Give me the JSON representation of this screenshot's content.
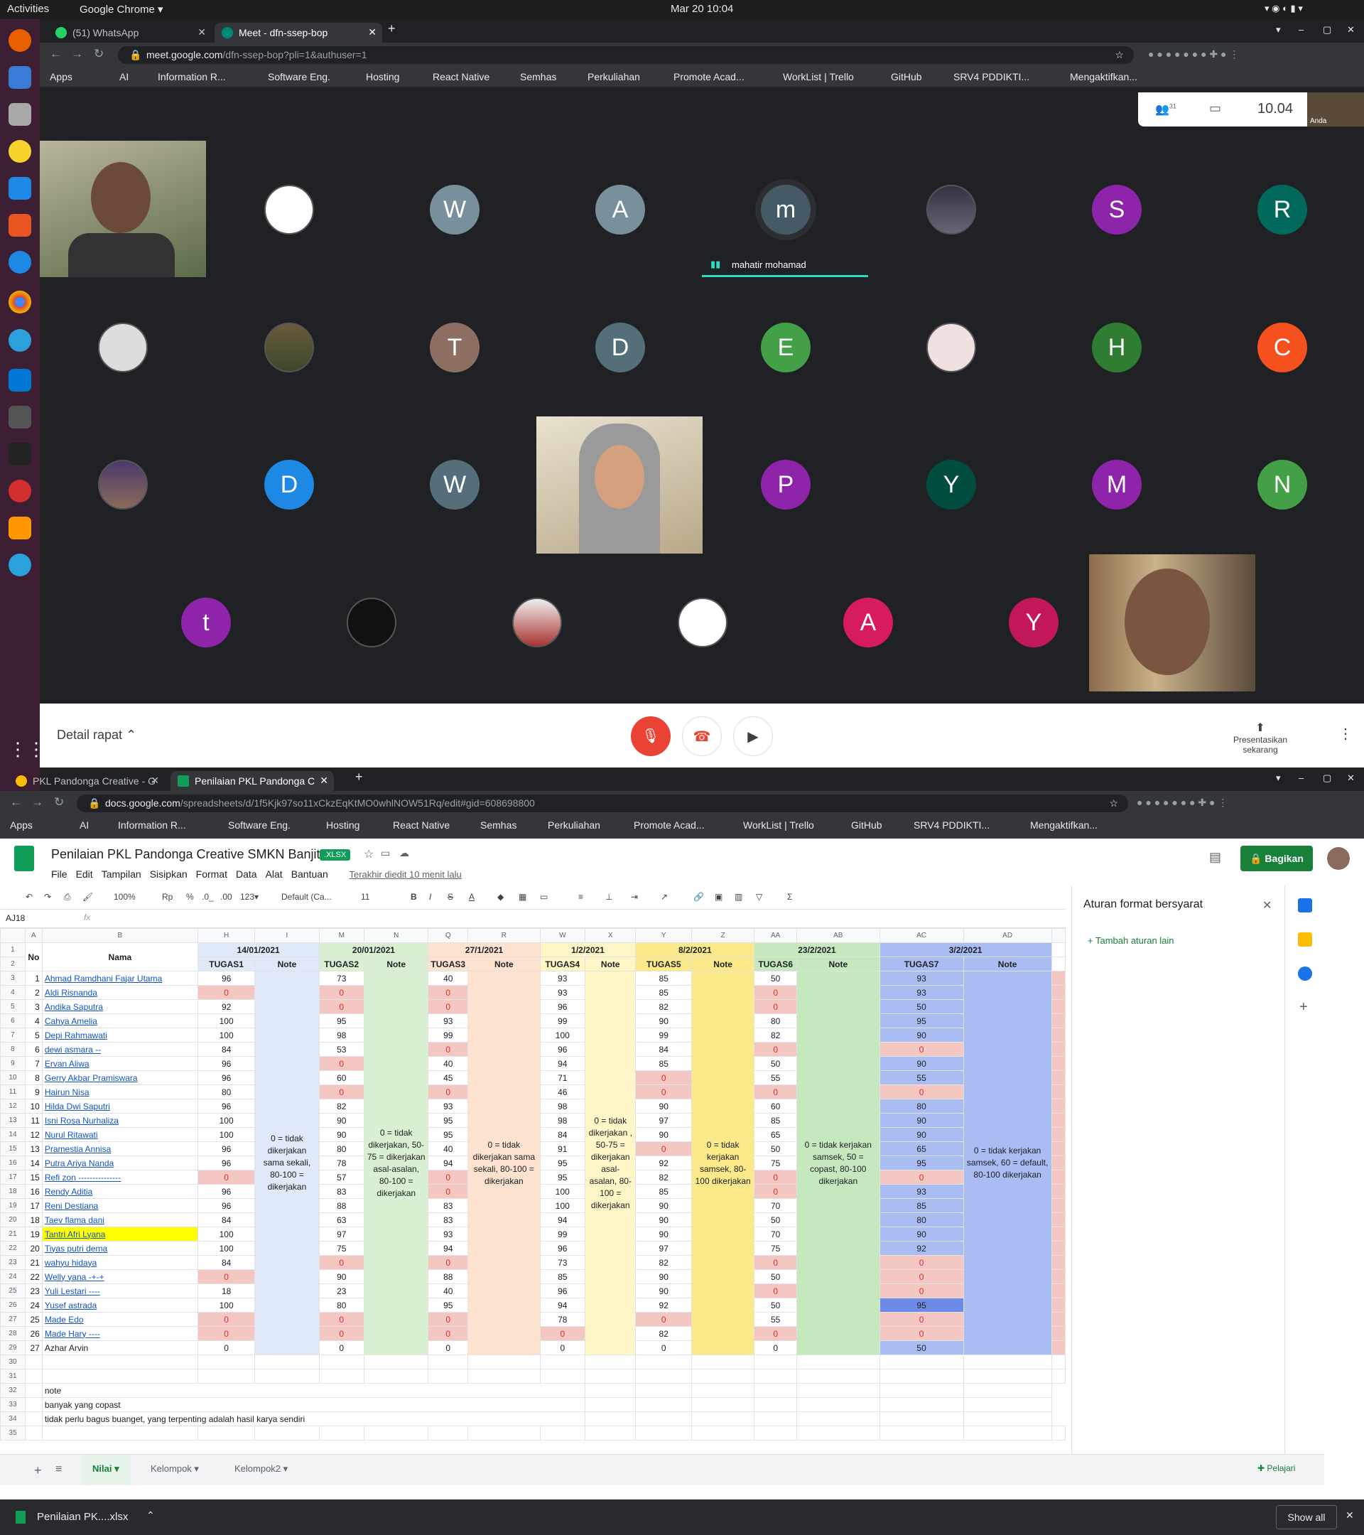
{
  "system": {
    "activities": "Activities",
    "app": "Google Chrome ▾",
    "clock": "Mar 20  10:04"
  },
  "meet_window": {
    "tabs": [
      {
        "label": "(51) WhatsApp"
      },
      {
        "label": "Meet - dfn-ssep-bop"
      }
    ],
    "url_host": "meet.google.com",
    "url_path": "/dfn-ssep-bop?pli=1&authuser=1",
    "bookmarks": [
      "Apps",
      "AI",
      "Information R...",
      "Software Eng.",
      "Hosting",
      "React Native",
      "Semhas",
      "Perkuliahan",
      "Promote Acad...",
      "WorkList | Trello",
      "GitHub",
      "SRV4 PDDIKTI...",
      "Mengaktifkan..."
    ],
    "participant_count": "31",
    "time": "10.04",
    "self_label": "Anda",
    "speaker_name": "mahatir mohamad",
    "rows": [
      [
        "video",
        "photo",
        "W",
        "A",
        "m",
        "photo",
        "S",
        "R"
      ],
      [
        "photo",
        "photo",
        "T",
        "D",
        "E",
        "photo",
        "H",
        "C"
      ],
      [
        "photo",
        "D",
        "W",
        "video",
        "P",
        "Y",
        "M",
        "N"
      ],
      [
        "t",
        "photo",
        "photo",
        "photo",
        "A",
        "Y",
        "video"
      ]
    ],
    "colors": {
      "W": "#78909c",
      "A": "#78909c",
      "m": "#455a64",
      "S": "#8e24aa",
      "R": "#00695c",
      "T": "#8d6e63",
      "D": "#546e7a",
      "E": "#43a047",
      "H": "#2e7d32",
      "C": "#f4511e",
      "P": "#8e24aa",
      "Y": "#004d40",
      "M": "#8e24aa",
      "N": "#43a047",
      "t": "#8e24aa",
      "A2": "#d81b60",
      "Y2": "#c2185b",
      "D2": "#1e88e5"
    },
    "details": "Detail rapat",
    "present": "Presentasikan sekarang"
  },
  "sheets_window": {
    "tabs": [
      {
        "label": "PKL Pandonga Creative - G"
      },
      {
        "label": "Penilaian PKL Pandonga C"
      }
    ],
    "url_host": "docs.google.com",
    "url_path": "/spreadsheets/d/1f5Kjk97so11xCkzEqKtMO0whlNOW51Rq/edit#gid=608698800",
    "title": "Penilaian PKL Pandonga Creative SMKN Banjit",
    "badge": ".XLSX",
    "menu": [
      "File",
      "Edit",
      "Tampilan",
      "Sisipkan",
      "Format",
      "Data",
      "Alat",
      "Bantuan"
    ],
    "last_edit": "Terakhir diedit 10 menit lalu",
    "share": "Bagikan",
    "toolbar": {
      "zoom": "100%",
      "currency": "Rp",
      "pct": "%",
      "dec0": ".0_",
      "dec00": ".00",
      "fmt": "123▾",
      "font": "Default (Ca...",
      "size": "11"
    },
    "cell_ref": "AJ18",
    "fx": "fx",
    "panel_title": "Aturan format bersyarat",
    "panel_add": "Tambah aturan lain",
    "col_letters": [
      "A",
      "B",
      "H",
      "I",
      "M",
      "N",
      "Q",
      "R",
      "W",
      "X",
      "Y",
      "Z",
      "AA",
      "AB",
      "AC",
      "AD"
    ],
    "dates": [
      "14/01/2021",
      "20/01/2021",
      "27/1/2021",
      "1/2/2021",
      "8/2/2021",
      "23/2/2021",
      "3/2/2021"
    ],
    "subheads": [
      "TUGAS1",
      "Note",
      "TUGAS2",
      "Note",
      "TUGAS3",
      "Note",
      "TUGAS4",
      "Note",
      "TUGAS5",
      "Note",
      "TUGAS6",
      "Note",
      "TUGAS7",
      "Note"
    ],
    "hdr_no": "No",
    "hdr_name": "Nama",
    "notes": [
      "0 = tidak dikerjakan sama sekali, 80-100 = dikerjakan",
      "0 = tidak dikerjakan, 50-75 = dikerjakan asal-asalan, 80-100 = dikerjakan",
      "0 = tidak dikerjakan sama sekali, 80-100 = dikerjakan",
      "0 = tidak dikerjakan , 50-75 = dikerjakan asal-asalan, 80-100 = dikerjakan",
      "0 = tidak kerjakan samsek, 80-100 dikerjakan",
      "0 = tidak kerjakan samsek, 50 = copast, 80-100 dikerjakan",
      "0 = tidak kerjakan samsek, 60 = default, 80-100 dikerjakan"
    ],
    "students": [
      [
        "1",
        "Ahmad Ramdhani Fajar Utama",
        "96",
        "73",
        "40",
        "93",
        "85",
        "50",
        "93"
      ],
      [
        "2",
        "Aldi Risnanda",
        "0",
        "0",
        "0",
        "93",
        "85",
        "0",
        "93"
      ],
      [
        "3",
        "Andika Saputra",
        "92",
        "0",
        "0",
        "96",
        "82",
        "0",
        "50"
      ],
      [
        "4",
        "Cahya Amelia ",
        "100",
        "95",
        "93",
        "99",
        "90",
        "80",
        "95"
      ],
      [
        "5",
        "Depi Rahmawati",
        "100",
        "98",
        "99",
        "100",
        "99",
        "82",
        "90"
      ],
      [
        "6",
        "dewi asmara --",
        "84",
        "53",
        "0",
        "96",
        "84",
        "0",
        "0"
      ],
      [
        "7",
        "Ervan Aliwa",
        "96",
        "0",
        "40",
        "94",
        "85",
        "50",
        "90"
      ],
      [
        "8",
        "Gerry Akbar Pramiswara",
        "96",
        "60",
        "45",
        "71",
        "0",
        "55",
        "55"
      ],
      [
        "9",
        "Hairun Nisa",
        "80",
        "0",
        "0",
        "46",
        "0",
        "0",
        "0"
      ],
      [
        "10",
        "Hilda Dwi Saputri",
        "96",
        "82",
        "93",
        "98",
        "90",
        "60",
        "80"
      ],
      [
        "11",
        "Isni Rosa Nurhaliza",
        "100",
        "90",
        "95",
        "98",
        "97",
        "85",
        "90"
      ],
      [
        "12",
        "Nurul Ritawati ",
        "100",
        "90",
        "95",
        "84",
        "90",
        "65",
        "90"
      ],
      [
        "13",
        "Pramestia Annisa",
        "96",
        "80",
        "40",
        "91",
        "0",
        "50",
        "65"
      ],
      [
        "14",
        "Putra Ariya Nanda",
        "96",
        "78",
        "94",
        "95",
        "92",
        "75",
        "95"
      ],
      [
        "15",
        "Refi zon ---------------",
        "0",
        "57",
        "0",
        "95",
        "82",
        "0",
        "0"
      ],
      [
        "16",
        "Rendy Aditia",
        "96",
        "83",
        "0",
        "100",
        "85",
        "0",
        "93"
      ],
      [
        "17",
        "Reni Destiana",
        "96",
        "88",
        "83",
        "100",
        "90",
        "70",
        "85"
      ],
      [
        "18",
        "Taev flama dani",
        "84",
        "63",
        "83",
        "94",
        "90",
        "50",
        "80"
      ],
      [
        "19",
        "Tantri Afri Lyana",
        "100",
        "97",
        "93",
        "99",
        "90",
        "70",
        "90"
      ],
      [
        "20",
        "Tiyas putri dema",
        "100",
        "75",
        "94",
        "96",
        "97",
        "75",
        "92"
      ],
      [
        "21",
        "wahyu hidaya",
        "84",
        "0",
        "0",
        "73",
        "82",
        "0",
        "0"
      ],
      [
        "22",
        "Welly yana -+-+",
        "0",
        "90",
        "88",
        "85",
        "90",
        "50",
        "0"
      ],
      [
        "23",
        "Yuli Lestari ----",
        "18",
        "23",
        "40",
        "96",
        "90",
        "0",
        "0"
      ],
      [
        "24",
        "Yusef astrada",
        "100",
        "80",
        "95",
        "94",
        "92",
        "50",
        "95"
      ],
      [
        "25",
        "Made Edo",
        "0",
        "0",
        "0",
        "78",
        "0",
        "55",
        "0"
      ],
      [
        "26",
        "Made Hary ----",
        "0",
        "0",
        "0",
        "0",
        "82",
        "0",
        "0"
      ],
      [
        "27",
        "Azhar Arvin",
        "0",
        "0",
        "0",
        "0",
        "0",
        "0",
        "50"
      ]
    ],
    "footnotes": [
      "note",
      "banyak yang copast",
      "tidak perlu bagus buanget, yang terpenting adalah hasil karya sendiri"
    ],
    "sheet_tabs": [
      "Nilai",
      "Kelompok",
      "Kelompok2"
    ],
    "learn": "Pelajari"
  },
  "download": {
    "file": "Penilaian PK....xlsx",
    "show_all": "Show all"
  }
}
